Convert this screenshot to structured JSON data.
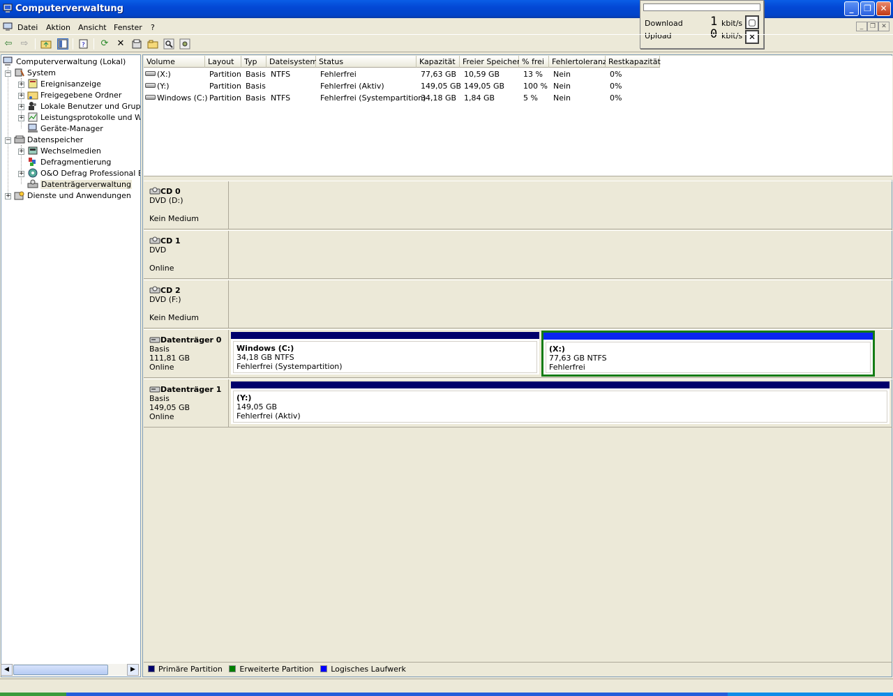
{
  "window": {
    "title": "Computerverwaltung"
  },
  "menu": {
    "items": [
      "Datei",
      "Aktion",
      "Ansicht",
      "Fenster",
      "?"
    ]
  },
  "net_widget": {
    "download_label": "Download",
    "download_value": "1",
    "upload_label": "Upload",
    "upload_value": "0",
    "unit": "kbit/s"
  },
  "tree": {
    "root": "Computerverwaltung (Lokal)",
    "system": "System",
    "system_children": [
      "Ereignisanzeige",
      "Freigegebene Ordner",
      "Lokale Benutzer und Gruppen",
      "Leistungsprotokolle und Warnungen",
      "Geräte-Manager"
    ],
    "storage": "Datenspeicher",
    "storage_children": [
      "Wechselmedien",
      "Defragmentierung",
      "O&O Defrag Professional Edition",
      "Datenträgerverwaltung"
    ],
    "services": "Dienste und Anwendungen"
  },
  "volume_list": {
    "columns": [
      "Volume",
      "Layout",
      "Typ",
      "Dateisystem",
      "Status",
      "Kapazität",
      "Freier Speicher",
      "% frei",
      "Fehlertoleranz",
      "Restkapazität"
    ],
    "rows": [
      [
        "(X:)",
        "Partition",
        "Basis",
        "NTFS",
        "Fehlerfrei",
        "77,63 GB",
        "10,59 GB",
        "13 %",
        "Nein",
        "0%"
      ],
      [
        "(Y:)",
        "Partition",
        "Basis",
        "",
        "Fehlerfrei (Aktiv)",
        "149,05 GB",
        "149,05 GB",
        "100 %",
        "Nein",
        "0%"
      ],
      [
        "Windows (C:)",
        "Partition",
        "Basis",
        "NTFS",
        "Fehlerfrei (Systempartition)",
        "34,18 GB",
        "1,84 GB",
        "5 %",
        "Nein",
        "0%"
      ]
    ]
  },
  "disks": [
    {
      "name": "CD 0",
      "type": "DVD (D:)",
      "size": "",
      "status": "Kein Medium"
    },
    {
      "name": "CD 1",
      "type": "DVD",
      "size": "",
      "status": "Online"
    },
    {
      "name": "CD 2",
      "type": "DVD (F:)",
      "size": "",
      "status": "Kein Medium"
    },
    {
      "name": "Datenträger 0",
      "type": "Basis",
      "size": "111,81 GB",
      "status": "Online",
      "partitions": [
        {
          "name": "Windows  (C:)",
          "detail": "34,18 GB NTFS",
          "status": "Fehlerfrei (Systempartition)"
        },
        {
          "name": "(X:)",
          "detail": "77,63 GB NTFS",
          "status": "Fehlerfrei"
        }
      ]
    },
    {
      "name": "Datenträger 1",
      "type": "Basis",
      "size": "149,05 GB",
      "status": "Online",
      "partitions": [
        {
          "name": "(Y:)",
          "detail": "149,05 GB",
          "status": "Fehlerfrei (Aktiv)"
        }
      ]
    }
  ],
  "legend": [
    {
      "label": "Primäre Partition",
      "color": "#00006b"
    },
    {
      "label": "Erweiterte Partition",
      "color": "#008000"
    },
    {
      "label": "Logisches Laufwerk",
      "color": "#0000ff"
    }
  ],
  "colors": {
    "primary": "#00006b",
    "extended": "#008000",
    "logical": "#0a24f0",
    "selection_border": "#147c14"
  }
}
